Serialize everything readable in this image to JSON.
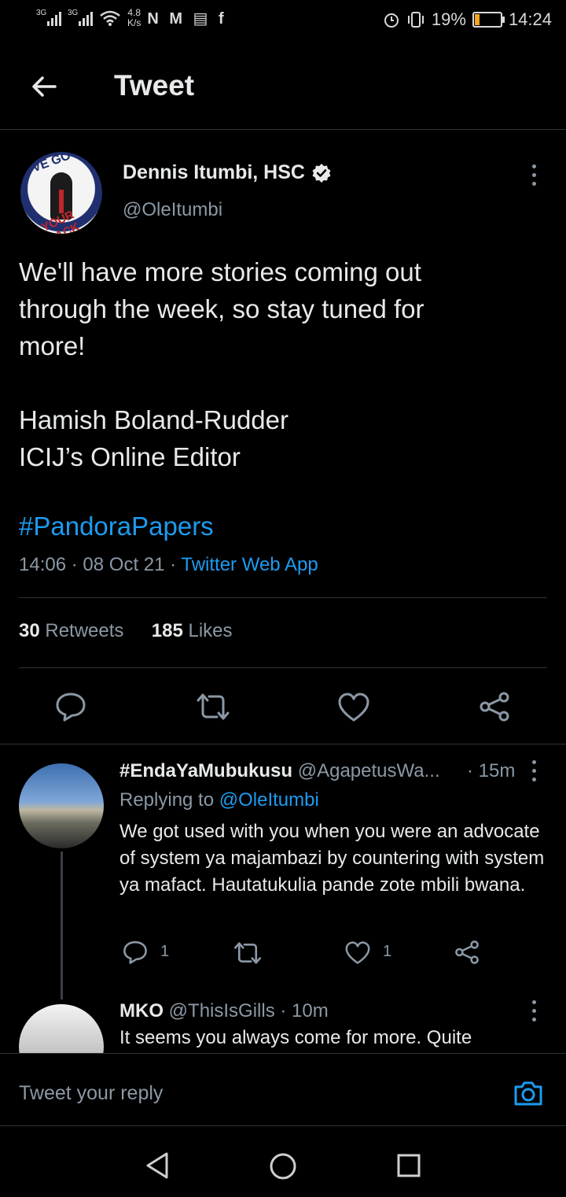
{
  "status_bar": {
    "signal1_label": "3G",
    "signal2_label": "3G",
    "speed_value": "4.8",
    "speed_unit": "K/s",
    "notification_icons": "N M ▤ f",
    "battery_percent": "19%",
    "battery_level": 0.19,
    "time": "14:24"
  },
  "header": {
    "title": "Tweet"
  },
  "tweet": {
    "author_name": "Dennis Itumbi, HSC",
    "handle": "@OleItumbi",
    "text_lines": [
      "We'll have more stories coming out",
      "through the week, so stay tuned for",
      "more!",
      "",
      "Hamish Boland-Rudder",
      "ICIJ’s Online Editor"
    ],
    "hashtag": "#PandoraPapers",
    "time": "14:06",
    "date": "08 Oct 21",
    "source": "Twitter Web App",
    "retweets": "30",
    "retweets_label": "Retweets",
    "likes": "185",
    "likes_label": "Likes",
    "avatar_text_top": "I'VE GOT",
    "avatar_text_bottom": "YOUR BACK"
  },
  "replies": [
    {
      "name": "#EndaYaMubukusu",
      "handle": "@AgapetusWa...",
      "time": "· 15m",
      "replying_prefix": "Replying to",
      "replying_to": "@OleItumbi",
      "text": "We got used with you when you were an advocate of system ya majambazi by countering with system ya  mafact. Hautatukulia pande zote mbili bwana.",
      "reply_count": "1",
      "like_count": "1"
    },
    {
      "name": "MKO",
      "handle": "@ThisIsGills",
      "time": "· 10m",
      "text": "It seems you always come for more. Quite"
    }
  ],
  "reply_bar": {
    "placeholder": "Tweet your reply"
  },
  "colors": {
    "accent": "#1d9bf0",
    "muted": "#8b98a5",
    "background": "#000000",
    "battery": "#f5a623"
  }
}
